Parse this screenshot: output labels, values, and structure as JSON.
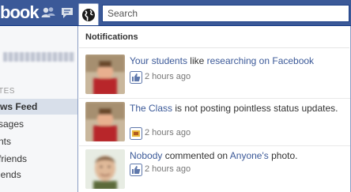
{
  "app": {
    "logo_text": "facebook"
  },
  "search": {
    "placeholder": "Search",
    "value": ""
  },
  "sidebar": {
    "profile_name_blurred": "",
    "section_label": "TES",
    "items": [
      {
        "label": "ws Feed",
        "active": true
      },
      {
        "label": "sages",
        "active": false
      },
      {
        "label": "nts",
        "active": false
      },
      {
        "label": "friends",
        "active": false
      },
      {
        "label": "iends",
        "active": false
      }
    ]
  },
  "notifications": {
    "header": "Notifications",
    "items": [
      {
        "actor": "Your students",
        "verb": " like ",
        "object": "researching on Facebook",
        "suffix": "",
        "time": "2 hours ago",
        "icon": "like-thumb-icon"
      },
      {
        "actor": "The Class",
        "verb": " is not posting pointless status updates.",
        "object": "",
        "suffix": "",
        "time": "2 hours ago",
        "icon": "status-update-icon"
      },
      {
        "actor": "Nobody",
        "verb": " commented on ",
        "object": "Anyone's",
        "suffix": " photo.",
        "time": "2 hours ago",
        "icon": "like-thumb-icon"
      }
    ]
  },
  "colors": {
    "topbar": "#3b5998",
    "link": "#3b5998",
    "sidebar_active": "#d8dfea"
  }
}
